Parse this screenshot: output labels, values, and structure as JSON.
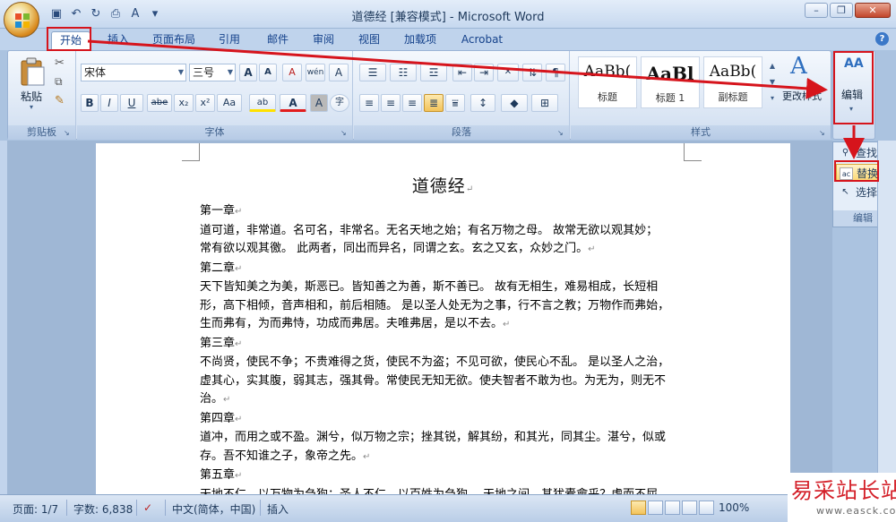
{
  "window": {
    "title": "道德经 [兼容模式] - Microsoft Word",
    "controls": [
      "minimize",
      "restore",
      "close"
    ]
  },
  "qat": {
    "icons": [
      "save-icon",
      "undo-icon",
      "redo-icon",
      "print-preview-icon",
      "spell-check-icon",
      "customize-icon"
    ]
  },
  "tabs": [
    {
      "label": "开始",
      "active": true
    },
    {
      "label": "插入"
    },
    {
      "label": "页面布局"
    },
    {
      "label": "引用"
    },
    {
      "label": "邮件"
    },
    {
      "label": "审阅"
    },
    {
      "label": "视图"
    },
    {
      "label": "加载项"
    },
    {
      "label": "Acrobat"
    }
  ],
  "ribbon": {
    "clipboard": {
      "label": "剪贴板",
      "paste_label": "粘贴"
    },
    "font": {
      "label": "字体",
      "font_name": "宋体",
      "font_size": "三号",
      "bold": "B",
      "italic": "I",
      "underline": "U",
      "strike": "abe",
      "subscript": "x₂",
      "superscript": "x²",
      "change_case": "Aa",
      "grow_font": "A",
      "shrink_font": "A",
      "clear_format": "A",
      "pinyin": "wén",
      "char_border": "A",
      "highlight": "ab",
      "font_color": "A",
      "char_shading": "A",
      "enclose": "字"
    },
    "paragraph": {
      "label": "段落"
    },
    "styles": {
      "label": "样式",
      "items": [
        {
          "sample": "AaBb(",
          "name": "标题"
        },
        {
          "sample": "AaBl",
          "name": "标题 1"
        },
        {
          "sample": "AaBb(",
          "name": "副标题"
        }
      ],
      "change_styles": "更改样式"
    },
    "editing": {
      "label": "编辑",
      "icon_text": "AA"
    }
  },
  "edit_popup": {
    "find": "查找",
    "replace": "替换",
    "select": "选择",
    "group_label": "编辑"
  },
  "document": {
    "title": "道德经",
    "lines": [
      "第一章",
      "道可道，非常道。名可名，非常名。无名天地之始；有名万物之母。 故常无欲以观其妙；",
      "常有欲以观其徼。 此两者，同出而异名，同谓之玄。玄之又玄，众妙之门。",
      "第二章",
      "天下皆知美之为美，斯恶已。皆知善之为善，斯不善已。 故有无相生，难易相成，长短相",
      "形，高下相倾，音声相和，前后相随。 是以圣人处无为之事，行不言之教；万物作而弗始，",
      "生而弗有，为而弗恃，功成而弗居。夫唯弗居，是以不去。",
      "第三章",
      "不尚贤，使民不争；不贵难得之货，使民不为盗；不见可欲，使民心不乱。 是以圣人之治，",
      "虚其心，实其腹，弱其志，强其骨。常使民无知无欲。使夫智者不敢为也。为无为，则无不",
      "治。",
      "第四章",
      "道冲，而用之或不盈。渊兮，似万物之宗；挫其锐，解其纷，和其光，同其尘。湛兮，似或",
      "存。吾不知谁之子，象帝之先。",
      "第五章",
      "天地不仁，以万物为刍狗；圣人不仁，以百姓为刍狗。 天地之间，其犹橐龠乎？虚而不屈，"
    ]
  },
  "statusbar": {
    "page": "页面: 1/7",
    "words": "字数: 6,838",
    "language": "中文(简体，中国)",
    "mode": "插入",
    "zoom": "100%"
  },
  "watermark": {
    "title": "易采站长站",
    "url": "www.easck.com"
  },
  "colors": {
    "annotation_red": "#d6141c",
    "ribbon_blue": "#bfd3ec",
    "watermark_red": "#d4212a"
  }
}
